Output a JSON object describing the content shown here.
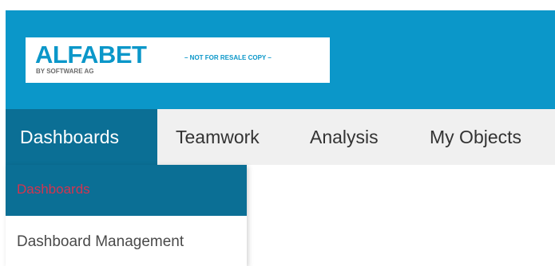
{
  "app": {
    "logo_title": "ALFABET",
    "logo_subtitle": "BY SOFTWARE AG",
    "logo_tagline": "– NOT FOR RESALE COPY –"
  },
  "nav": {
    "items": [
      {
        "label": "Dashboards",
        "active": true
      },
      {
        "label": "Teamwork",
        "active": false
      },
      {
        "label": "Analysis",
        "active": false
      },
      {
        "label": "My Objects",
        "active": false
      }
    ]
  },
  "dropdown": {
    "header_label": "Dashboards",
    "items": [
      {
        "label": "Dashboard Management"
      }
    ]
  },
  "colors": {
    "header_bg": "#0b97c9",
    "active_bg": "#0b6f95",
    "nav_bg": "#f0f0f0",
    "dropdown_header_text": "#d4344f"
  }
}
